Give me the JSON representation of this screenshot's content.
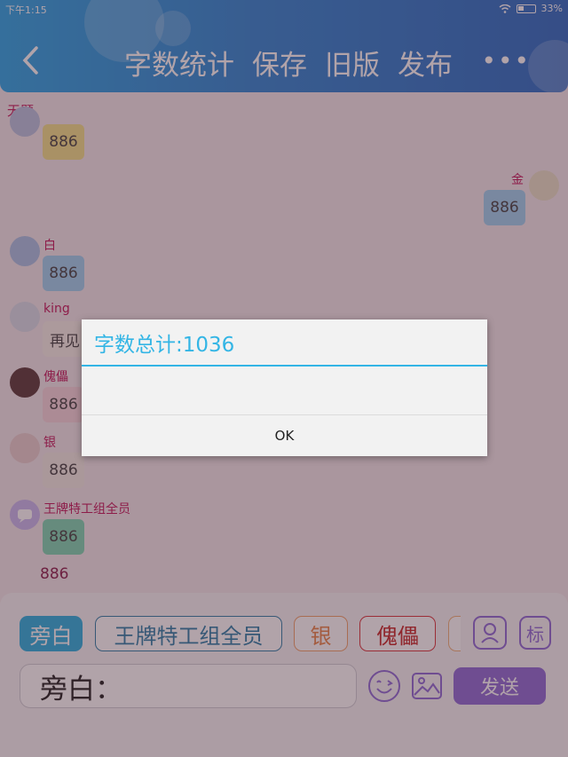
{
  "status": {
    "time": "下午1:15",
    "battery": "33%"
  },
  "header": {
    "tabs": [
      "字数统计",
      "保存",
      "旧版",
      "发布"
    ],
    "more": "•••"
  },
  "chat": {
    "title": "无题",
    "messages": [
      {
        "name": "",
        "text": "886"
      },
      {
        "name": "金",
        "text": "886"
      },
      {
        "name": "白",
        "text": "886"
      },
      {
        "name": "king",
        "text": "再见"
      },
      {
        "name": "傀儡",
        "text": "886"
      },
      {
        "name": "银",
        "text": "886"
      },
      {
        "name": "王牌特工组全员",
        "text": "886"
      }
    ],
    "narration": "886"
  },
  "bottom": {
    "chips": [
      "旁白",
      "王牌特工组全员",
      "银",
      "傀儡"
    ],
    "label_icon": "标",
    "input_value": "旁白：",
    "send_label": "发送"
  },
  "dialog": {
    "title": "字数总计:1036",
    "ok": "OK"
  },
  "colors": {
    "header": "#2f86d4",
    "accent": "#33b5e5",
    "send": "#8e6bd6",
    "name": "#c2185b"
  }
}
